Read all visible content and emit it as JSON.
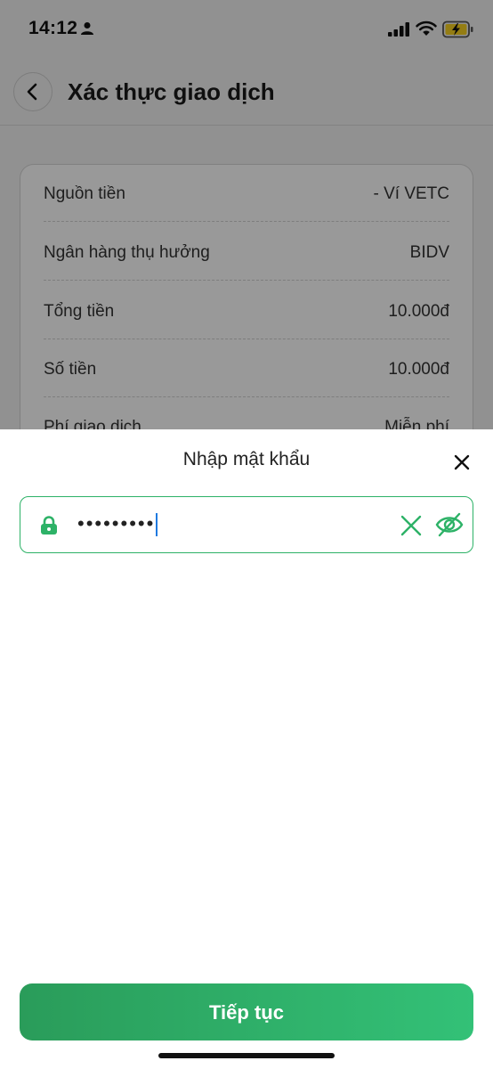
{
  "status_bar": {
    "time": "14:12"
  },
  "header": {
    "title": "Xác thực giao dịch"
  },
  "transaction": {
    "rows": [
      {
        "label": "Nguồn tiền",
        "value": "- Ví VETC"
      },
      {
        "label": "Ngân hàng thụ hưởng",
        "value": "BIDV"
      },
      {
        "label": "Tổng tiền",
        "value": "10.000đ"
      },
      {
        "label": "Số tiền",
        "value": "10.000đ"
      },
      {
        "label": "Phí giao dịch",
        "value": "Miễn phí"
      }
    ]
  },
  "password_sheet": {
    "title": "Nhập mật khẩu",
    "password_masked": "•••••••••"
  },
  "continue_button": {
    "label": "Tiếp tục"
  },
  "colors": {
    "accent_green": "#2db267"
  }
}
